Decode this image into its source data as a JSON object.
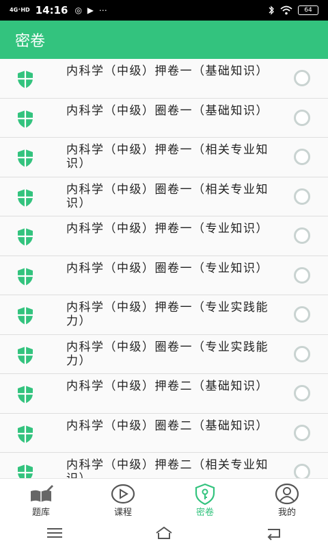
{
  "status": {
    "network": "4G⁺HD",
    "time": "14:16",
    "extra_icons": "◎ ▶ ⋯",
    "battery": "64"
  },
  "appbar": {
    "title": "密卷"
  },
  "items": [
    {
      "title": "内科学（中级）押卷一（基础知识）"
    },
    {
      "title": "内科学（中级）圈卷一（基础知识）"
    },
    {
      "title": "内科学（中级）押卷一（相关专业知识）"
    },
    {
      "title": "内科学（中级）圈卷一（相关专业知识）"
    },
    {
      "title": "内科学（中级）押卷一（专业知识）"
    },
    {
      "title": "内科学（中级）圈卷一（专业知识）"
    },
    {
      "title": "内科学（中级）押卷一（专业实践能力）"
    },
    {
      "title": "内科学（中级）圈卷一（专业实践能力）"
    },
    {
      "title": "内科学（中级）押卷二（基础知识）"
    },
    {
      "title": "内科学（中级）圈卷二（基础知识）"
    },
    {
      "title": "内科学（中级）押卷二（相关专业知识）"
    }
  ],
  "tabs": [
    {
      "label": "题库",
      "icon": "book-pen-icon"
    },
    {
      "label": "课程",
      "icon": "play-circle-icon"
    },
    {
      "label": "密卷",
      "icon": "shield-key-icon",
      "active": true
    },
    {
      "label": "我的",
      "icon": "user-icon"
    }
  ],
  "colors": {
    "accent": "#33c37e",
    "radio": "#c9d3d1",
    "divider": "#dedede"
  }
}
